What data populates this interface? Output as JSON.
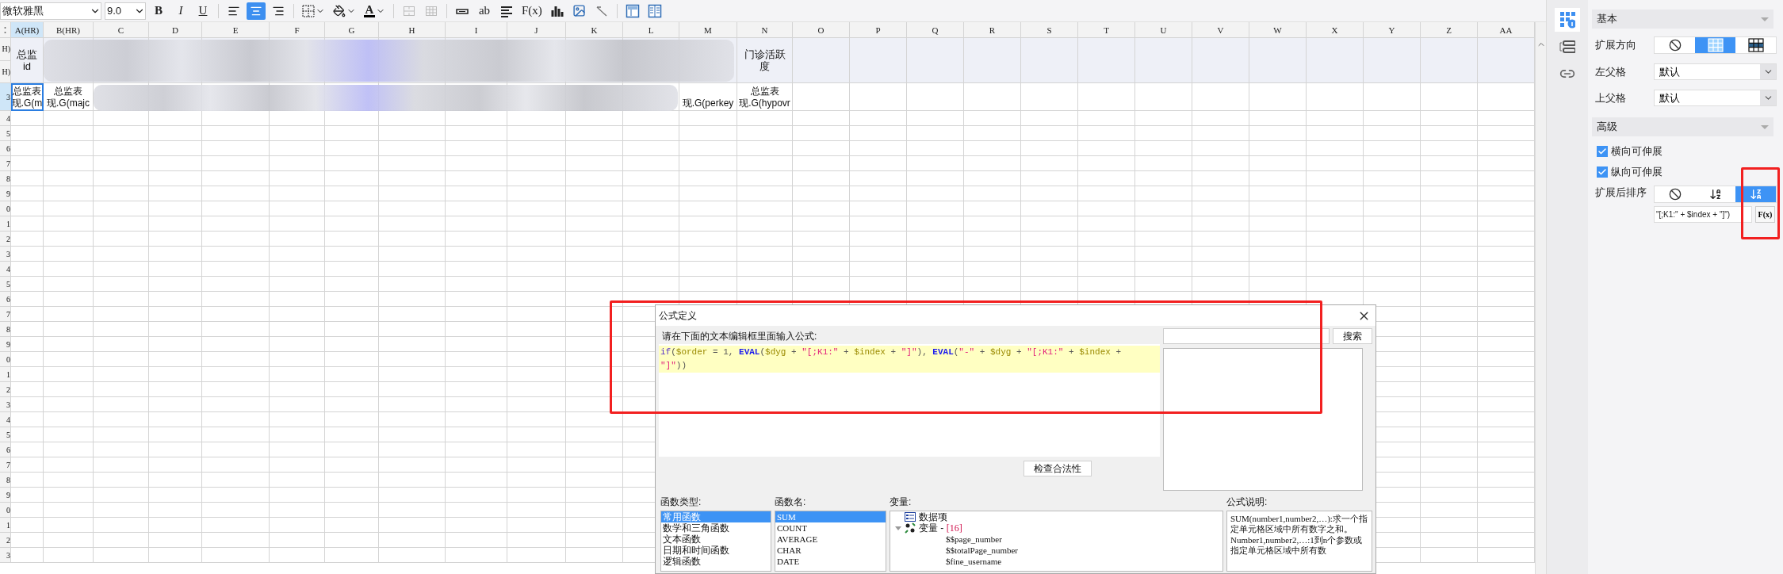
{
  "toolbar": {
    "font": "微软雅黑",
    "size": "9.0",
    "styles": [
      {
        "kind": "bold",
        "text": "B"
      },
      {
        "kind": "italic",
        "text": "I"
      },
      {
        "kind": "underline",
        "text": "U"
      }
    ],
    "align": [
      {
        "kind": "left",
        "selected": false
      },
      {
        "kind": "center",
        "selected": true
      },
      {
        "kind": "right",
        "selected": false
      }
    ],
    "format": [
      {
        "kind": "border"
      },
      {
        "kind": "fill"
      },
      {
        "kind": "font-color",
        "text": "A"
      }
    ],
    "merge": [
      {
        "kind": "merge",
        "disabled": true
      },
      {
        "kind": "unmerge",
        "disabled": true
      }
    ],
    "insert": [
      {
        "kind": "field"
      },
      {
        "kind": "text",
        "text": "ab"
      },
      {
        "kind": "rich-text"
      },
      {
        "kind": "formula",
        "text": "F(x)"
      },
      {
        "kind": "chart"
      },
      {
        "kind": "image"
      },
      {
        "kind": "slash"
      }
    ],
    "layout": [
      {
        "kind": "frozen"
      },
      {
        "kind": "columns"
      }
    ]
  },
  "sheet": {
    "columns": [
      {
        "label": "A(HR)",
        "selected": true,
        "merged_cell": "总监id",
        "row3": {
          "lines": [
            "总监表",
            "现.G(m"
          ],
          "selected": true
        }
      },
      {
        "label": "B(HR)",
        "selected": false,
        "row3": {
          "lines": [
            "总监表",
            "现.G(majc"
          ],
          "selected": false
        }
      },
      {
        "label": "C",
        "selected": false
      },
      {
        "label": "D",
        "selected": false
      },
      {
        "label": "E",
        "selected": false
      },
      {
        "label": "F",
        "selected": false
      },
      {
        "label": "G",
        "selected": false
      },
      {
        "label": "H",
        "selected": false
      },
      {
        "label": "I",
        "selected": false
      },
      {
        "label": "J",
        "selected": false
      },
      {
        "label": "K",
        "selected": false
      },
      {
        "label": "L",
        "selected": false
      },
      {
        "label": "M",
        "selected": false,
        "row3": {
          "lines": [
            "现.G(perkey"
          ],
          "selected": false
        }
      },
      {
        "label": "N",
        "selected": false,
        "merged_cell": "门诊活跃度",
        "row3": {
          "lines": [
            "总监表",
            "现.G(hypovr"
          ],
          "selected": false
        }
      },
      {
        "label": "O",
        "selected": false
      },
      {
        "label": "P",
        "selected": false
      },
      {
        "label": "Q",
        "selected": false
      },
      {
        "label": "R",
        "selected": false
      },
      {
        "label": "S",
        "selected": false
      },
      {
        "label": "T",
        "selected": false
      },
      {
        "label": "U",
        "selected": false
      },
      {
        "label": "V",
        "selected": false
      },
      {
        "label": "W",
        "selected": false
      },
      {
        "label": "X",
        "selected": false
      },
      {
        "label": "Y",
        "selected": false
      },
      {
        "label": "Z",
        "selected": false
      },
      {
        "label": "AA",
        "selected": false
      }
    ],
    "rows": [
      {
        "label": "H)",
        "selected": false
      },
      {
        "label": "H)",
        "selected": false
      },
      {
        "label": "3",
        "selected": true
      },
      {
        "label": "4",
        "selected": false
      },
      {
        "label": "5",
        "selected": false
      },
      {
        "label": "6",
        "selected": false
      },
      {
        "label": "7",
        "selected": false
      },
      {
        "label": "8",
        "selected": false
      },
      {
        "label": "9",
        "selected": false
      },
      {
        "label": "0",
        "selected": false
      },
      {
        "label": "1",
        "selected": false
      },
      {
        "label": "2",
        "selected": false
      },
      {
        "label": "3",
        "selected": false
      },
      {
        "label": "4",
        "selected": false
      },
      {
        "label": "5",
        "selected": false
      },
      {
        "label": "6",
        "selected": false
      },
      {
        "label": "7",
        "selected": false
      },
      {
        "label": "8",
        "selected": false
      },
      {
        "label": "9",
        "selected": false
      },
      {
        "label": "0",
        "selected": false
      },
      {
        "label": "1",
        "selected": false
      },
      {
        "label": "2",
        "selected": false
      },
      {
        "label": "3",
        "selected": false
      },
      {
        "label": "4",
        "selected": false
      },
      {
        "label": "5",
        "selected": false
      },
      {
        "label": "6",
        "selected": false
      },
      {
        "label": "7",
        "selected": false
      },
      {
        "label": "8",
        "selected": false
      },
      {
        "label": "9",
        "selected": false
      },
      {
        "label": "0",
        "selected": false
      },
      {
        "label": "1",
        "selected": false
      },
      {
        "label": "2",
        "selected": false
      },
      {
        "label": "3",
        "selected": false
      }
    ]
  },
  "side_tabs": [
    {
      "kind": "cell-attributes",
      "selected": true
    },
    {
      "kind": "layout",
      "selected": false
    },
    {
      "kind": "link",
      "selected": false
    }
  ],
  "basic": {
    "title": "基本",
    "expand_direction": {
      "label": "扩展方向",
      "options": [
        {
          "kind": "none",
          "selected": false
        },
        {
          "kind": "vertical",
          "selected": true
        },
        {
          "kind": "horizontal",
          "selected": false
        }
      ]
    },
    "left_parent": {
      "label": "左父格",
      "value": "默认"
    },
    "top_parent": {
      "label": "上父格",
      "value": "默认"
    }
  },
  "advanced": {
    "title": "高级",
    "checkboxes": [
      {
        "label": "横向可伸展",
        "checked": true
      },
      {
        "label": "纵向可伸展",
        "checked": true
      }
    ],
    "sort": {
      "label": "扩展后排序",
      "options": [
        {
          "kind": "none",
          "selected": false
        },
        {
          "kind": "ascending",
          "selected": false
        },
        {
          "kind": "descending",
          "selected": true
        }
      ],
      "formula": "\"[;K1:\" + $index + \"]\")",
      "formula_button": "F(x)"
    }
  },
  "dialog": {
    "title": "公式定义",
    "prompt": "请在下面的文本编辑框里面输入公式:",
    "current_line_highlighted": true,
    "formula_lines": [
      [
        {
          "kind": "keyword",
          "text": "if"
        },
        {
          "kind": "plain",
          "text": "("
        },
        {
          "kind": "var",
          "text": "$order"
        },
        {
          "kind": "plain",
          "text": " = 1, "
        },
        {
          "kind": "func",
          "text": "EVAL"
        },
        {
          "kind": "plain",
          "text": "("
        },
        {
          "kind": "var",
          "text": "$dyg"
        },
        {
          "kind": "plain",
          "text": " + "
        },
        {
          "kind": "string",
          "text": "\"[;K1:\""
        },
        {
          "kind": "plain",
          "text": " + "
        },
        {
          "kind": "var",
          "text": "$index"
        },
        {
          "kind": "plain",
          "text": " + "
        },
        {
          "kind": "string",
          "text": "\"]\""
        },
        {
          "kind": "plain",
          "text": "), "
        },
        {
          "kind": "func",
          "text": "EVAL"
        },
        {
          "kind": "plain",
          "text": "("
        },
        {
          "kind": "string",
          "text": "\"-\""
        },
        {
          "kind": "plain",
          "text": " + "
        },
        {
          "kind": "var",
          "text": "$dyg"
        },
        {
          "kind": "plain",
          "text": " + "
        },
        {
          "kind": "string",
          "text": "\"[;K1:\""
        },
        {
          "kind": "plain",
          "text": " + "
        },
        {
          "kind": "var",
          "text": "$index"
        },
        {
          "kind": "plain",
          "text": " +"
        }
      ],
      [
        {
          "kind": "string",
          "text": "\"]\""
        },
        {
          "kind": "plain",
          "text": "))"
        }
      ]
    ],
    "search_button": "搜索",
    "check_button": "检查合法性",
    "function_types": {
      "label": "函数类型:",
      "items": [
        {
          "text": "常用函数",
          "selected": true
        },
        {
          "text": "数学和三角函数",
          "selected": false
        },
        {
          "text": "文本函数",
          "selected": false
        },
        {
          "text": "日期和时间函数",
          "selected": false
        },
        {
          "text": "逻辑函数",
          "selected": false
        }
      ]
    },
    "function_names": {
      "label": "函数名:",
      "items": [
        {
          "text": "SUM",
          "selected": true
        },
        {
          "text": "COUNT",
          "selected": false
        },
        {
          "text": "AVERAGE",
          "selected": false
        },
        {
          "text": "CHAR",
          "selected": false
        },
        {
          "text": "DATE",
          "selected": false
        }
      ]
    },
    "variables": {
      "label": "变量:",
      "items": [
        {
          "kind": "dataset",
          "text": "数据项"
        },
        {
          "kind": "group",
          "text": "变量 -",
          "count": "[16]",
          "expanded": true,
          "children": [
            {
              "text": "$$page_number"
            },
            {
              "text": "$$totalPage_number"
            },
            {
              "text": "$fine_username"
            }
          ]
        }
      ]
    },
    "description": {
      "label": "公式说明:",
      "paragraphs": [
        "SUM(number1,number2,…):求一个指定单元格区域中所有数字之和。",
        "Number1,number2,…:1到n个参数或指定单元格区域中所有数"
      ]
    }
  }
}
